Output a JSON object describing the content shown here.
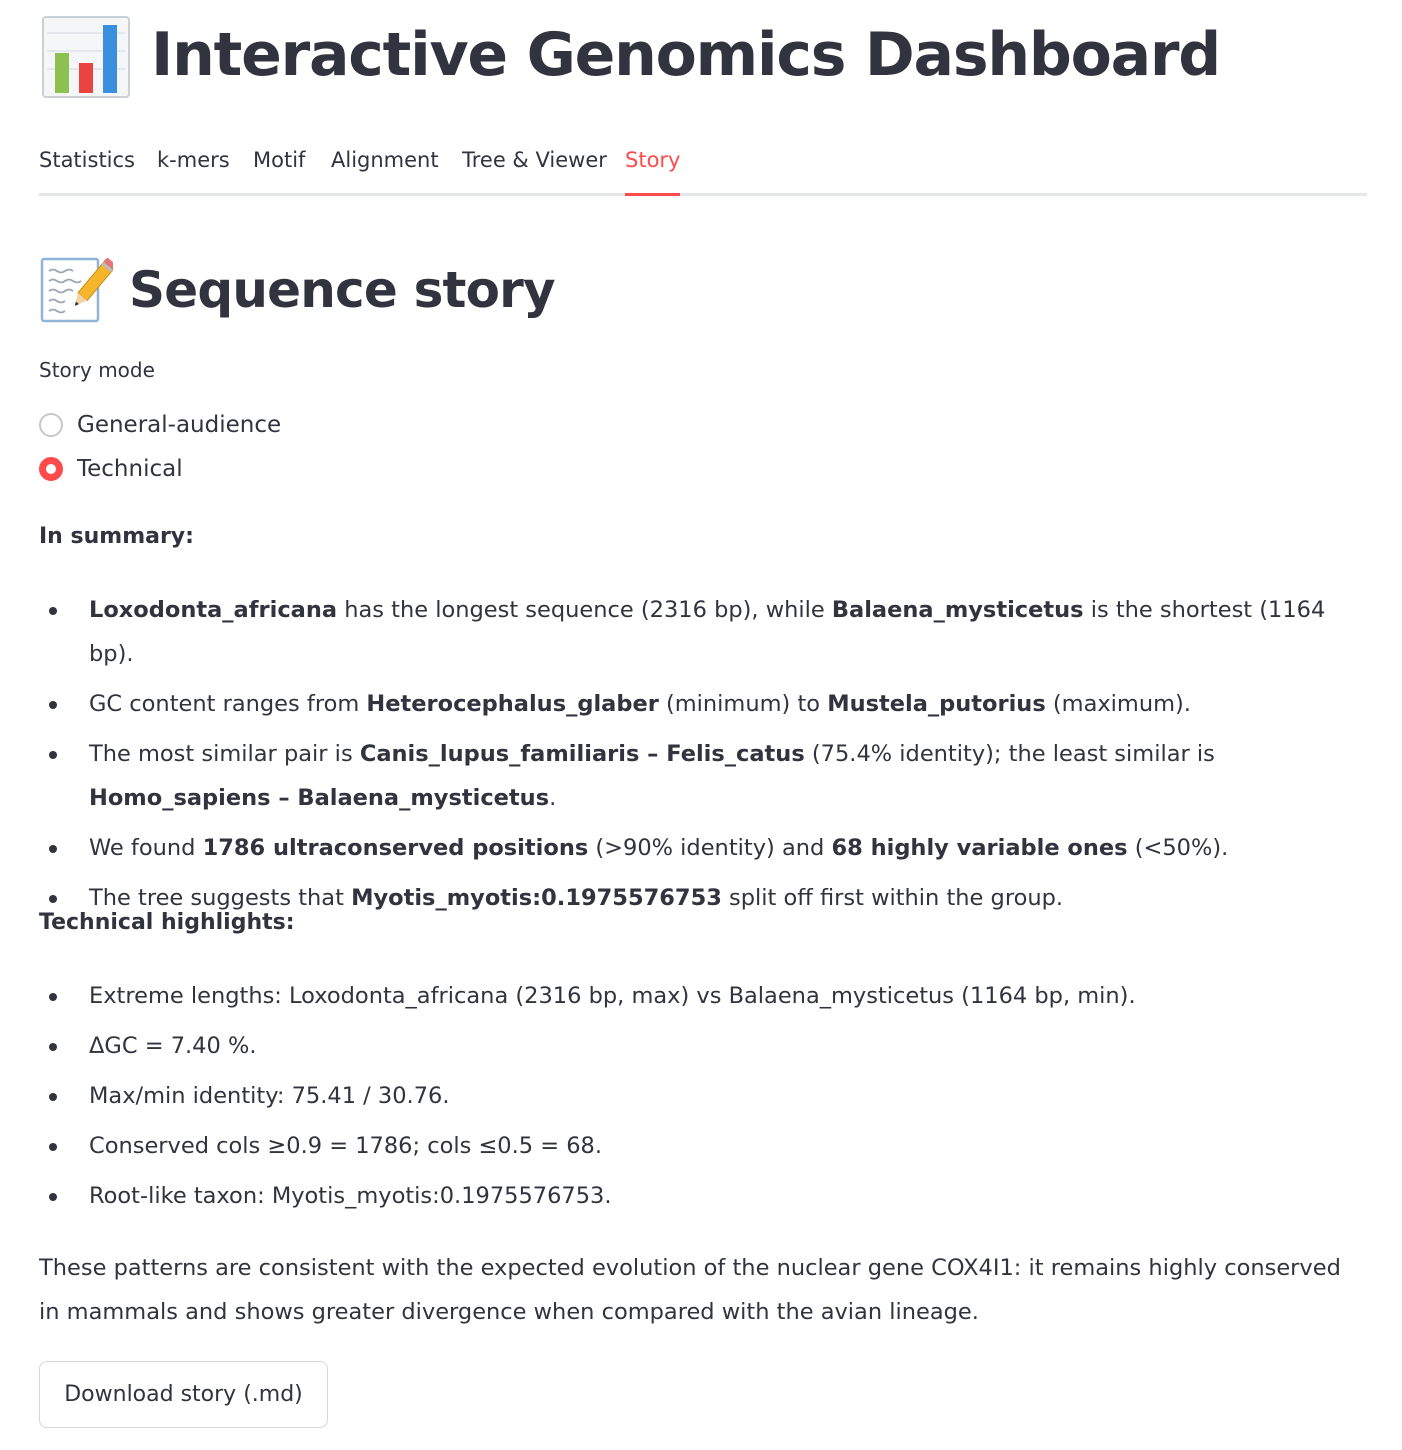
{
  "app": {
    "title": "Interactive Genomics Dashboard",
    "icon": "bar-chart-icon"
  },
  "tabs": [
    {
      "label": "Statistics",
      "active": false
    },
    {
      "label": "k-mers",
      "active": false
    },
    {
      "label": "Motif",
      "active": false
    },
    {
      "label": "Alignment",
      "active": false
    },
    {
      "label": "Tree & Viewer",
      "active": false
    },
    {
      "label": "Story",
      "active": true
    }
  ],
  "section": {
    "title": "Sequence story",
    "icon": "memo-pencil-icon"
  },
  "story_mode": {
    "label": "Story mode",
    "options": [
      "General-audience",
      "Technical"
    ],
    "selected": "Technical"
  },
  "summary": {
    "heading": "In summary:",
    "items": {
      "longest": {
        "pre": "",
        "b1": "Loxodonta_africana",
        "mid": " has the longest sequence (2316 bp), while ",
        "b2": "Balaena_mysticetus",
        "post": " is the shortest (1164 bp)."
      },
      "gc": {
        "pre": "GC content ranges from ",
        "b1": "Heterocephalus_glaber",
        "mid": " (minimum) to ",
        "b2": "Mustela_putorius",
        "post": " (maximum)."
      },
      "similar": {
        "pre": "The most similar pair is ",
        "b1": "Canis_lupus_familiaris – Felis_catus",
        "mid": " (75.4% identity); the least similar is ",
        "b2": "Homo_sapiens – Balaena_mysticetus",
        "post": "."
      },
      "conserved": {
        "pre": "We found ",
        "b1": "1786 ultraconserved positions",
        "mid": " (>90% identity) and ",
        "b2": "68 highly variable ones",
        "post": " (<50%)."
      },
      "tree": {
        "pre": "The tree suggests that ",
        "b1": "Myotis_myotis:0.1975576753",
        "post": " split off first within the group."
      }
    }
  },
  "technical": {
    "heading": "Technical highlights:",
    "items": [
      "Extreme lengths: Loxodonta_africana (2316 bp, max) vs Balaena_mysticetus (1164 bp, min).",
      "ΔGC = 7.40 %.",
      "Max/min identity: 75.41 / 30.76.",
      "Conserved cols ≥0.9 = 1786; cols ≤0.5 = 68.",
      "Root-like taxon: Myotis_myotis:0.1975576753."
    ]
  },
  "conclusion": "These patterns are consistent with the expected evolution of the nuclear gene COX4I1: it remains highly conserved in mammals and shows greater divergence when compared with the avian lineage.",
  "download": {
    "label": "Download story (.md)"
  },
  "colors": {
    "accent": "#ff4b4b",
    "text": "#31333f",
    "border": "#e6e7eb"
  }
}
